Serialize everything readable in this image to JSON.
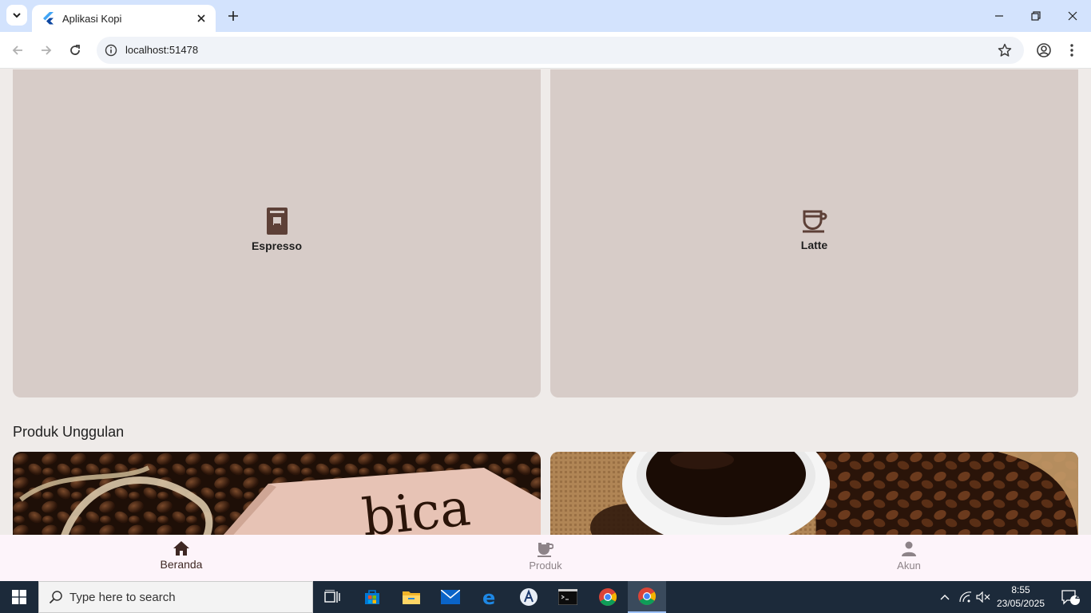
{
  "browser": {
    "tab_title": "Aplikasi Kopi",
    "url": "localhost:51478"
  },
  "categories": [
    {
      "label": "Espresso",
      "icon": "espresso-machine-icon"
    },
    {
      "label": "Latte",
      "icon": "coffee-cup-icon"
    }
  ],
  "featured": {
    "title": "Produk Unggulan",
    "image_text": "bica"
  },
  "bottom_nav": {
    "items": [
      {
        "label": "Beranda",
        "icon": "home-icon",
        "selected": true
      },
      {
        "label": "Produk",
        "icon": "coffee-cup-icon",
        "selected": false
      },
      {
        "label": "Akun",
        "icon": "person-icon",
        "selected": false
      }
    ]
  },
  "taskbar": {
    "search_placeholder": "Type here to search",
    "time": "8:55",
    "date": "23/05/2025",
    "notification_count": "2"
  },
  "colors": {
    "card": "#d7ccc8",
    "background": "#efebe9",
    "icon_brown": "#5d4037",
    "nav_bg": "#fdf4fa"
  }
}
